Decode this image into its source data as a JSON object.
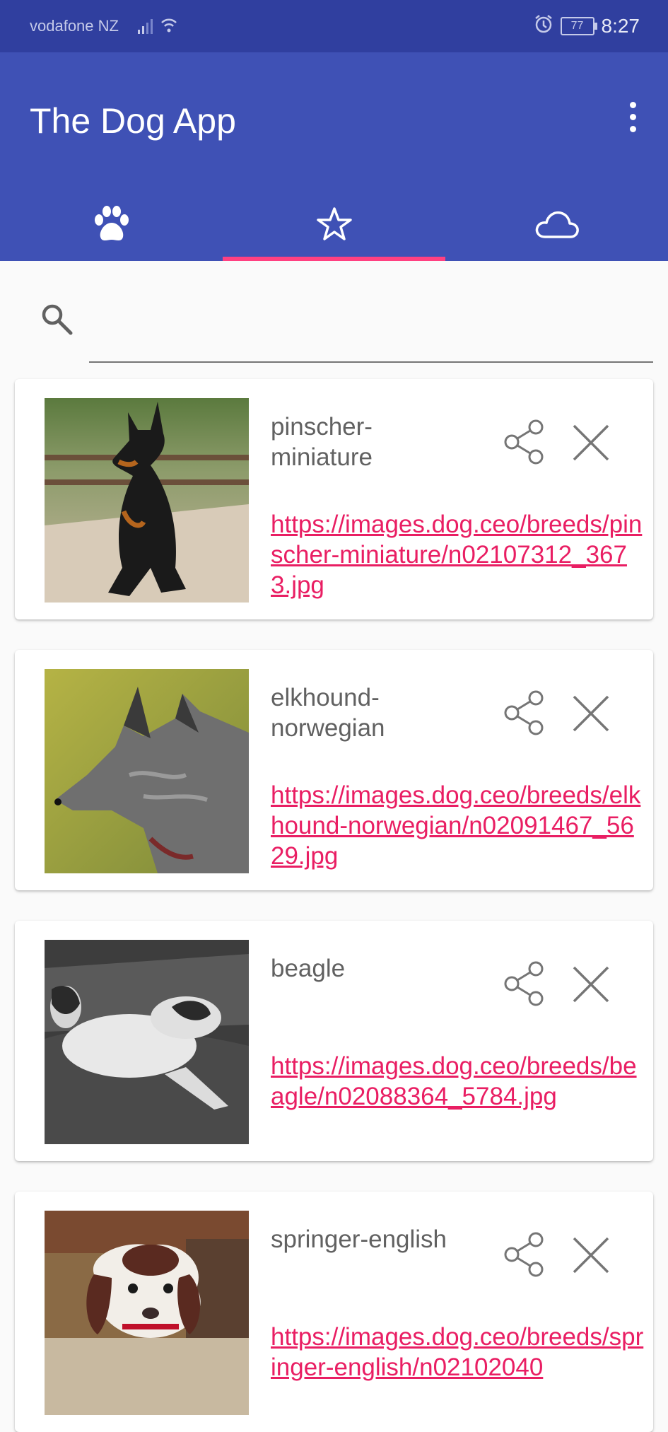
{
  "status": {
    "carrier": "vodafone NZ",
    "battery": "77",
    "time": "8:27"
  },
  "app": {
    "title": "The Dog App"
  },
  "tabs": [
    {
      "icon": "paw-icon",
      "active": false
    },
    {
      "icon": "star-icon",
      "active": true
    },
    {
      "icon": "cloud-icon",
      "active": false
    }
  ],
  "search": {
    "placeholder": "",
    "value": ""
  },
  "favorites": [
    {
      "breed": "pinscher-\nminiature",
      "url": "https://images.dog.ceo/breeds/pinscher-miniature/n02107312_3673.jpg"
    },
    {
      "breed": "elkhound-\nnorwegian",
      "url": "https://images.dog.ceo/breeds/elkhound-norwegian/n02091467_5629.jpg"
    },
    {
      "breed": "beagle",
      "url": "https://images.dog.ceo/breeds/beagle/n02088364_5784.jpg"
    },
    {
      "breed": "springer-english",
      "url": "https://images.dog.ceo/breeds/springer-english/n02102040"
    }
  ],
  "colors": {
    "primary": "#3f51b5",
    "primary_dark": "#303f9f",
    "accent": "#ff4081",
    "link": "#e91e63"
  }
}
